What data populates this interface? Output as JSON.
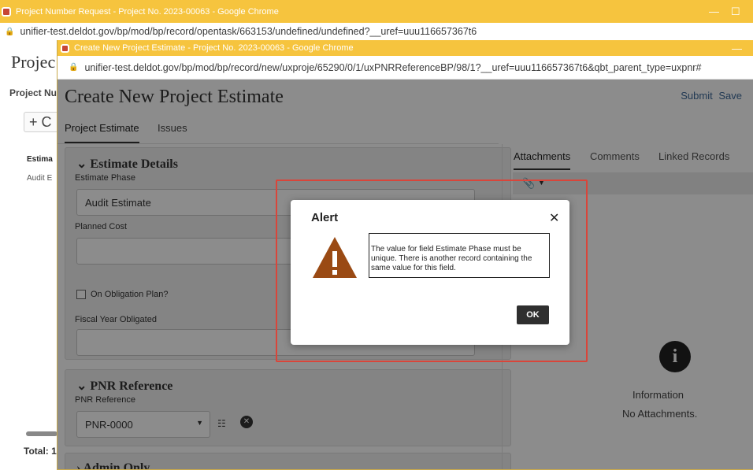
{
  "outer": {
    "title": "Project Number Request - Project No. 2023-00063 - Google Chrome",
    "url": "unifier-test.deldot.gov/bp/mod/bp/record/opentask/663153/undefined/undefined?__uref=uuu116657367t6",
    "page_title": "Projec",
    "subtitle": "Project Nu",
    "add_label": "+ C",
    "column_header": "Estima",
    "cell": "Audit E",
    "total": "Total: 1"
  },
  "inner": {
    "title": "Create New Project Estimate - Project No. 2023-00063 - Google Chrome",
    "url": "unifier-test.deldot.gov/bp/mod/bp/record/new/uxproje/65290/0/1/uxPNRReferenceBP/98/1?__uref=uuu116657367t6&qbt_parent_type=uxpnr#",
    "page_title": "Create New Project Estimate",
    "actions": {
      "submit": "Submit",
      "save": "Save"
    },
    "tabs": [
      "Project Estimate",
      "Issues"
    ],
    "estimate_details": {
      "header": "Estimate Details",
      "estimate_phase_label": "Estimate Phase",
      "estimate_phase_value": "Audit Estimate",
      "planned_cost_label": "Planned Cost",
      "planned_cost_value": "",
      "obligation_label": "On Obligation Plan?",
      "fiscal_year_label": "Fiscal Year Obligated",
      "fiscal_year_value": ""
    },
    "pnr_reference": {
      "header": "PNR Reference",
      "field_label": "PNR Reference",
      "field_value": "PNR-0000"
    },
    "admin_only_header": "Admin Only",
    "right_panel": {
      "tabs": [
        "Attachments",
        "Comments",
        "Linked Records"
      ],
      "info_title": "Information",
      "info_message": "No Attachments."
    }
  },
  "alert": {
    "title": "Alert",
    "message": "The value for field Estimate Phase must be unique. There is another record containing the same value for this field.",
    "ok_label": "OK",
    "warning_color": "#9a4a14",
    "highlight_color": "#d9453a"
  }
}
